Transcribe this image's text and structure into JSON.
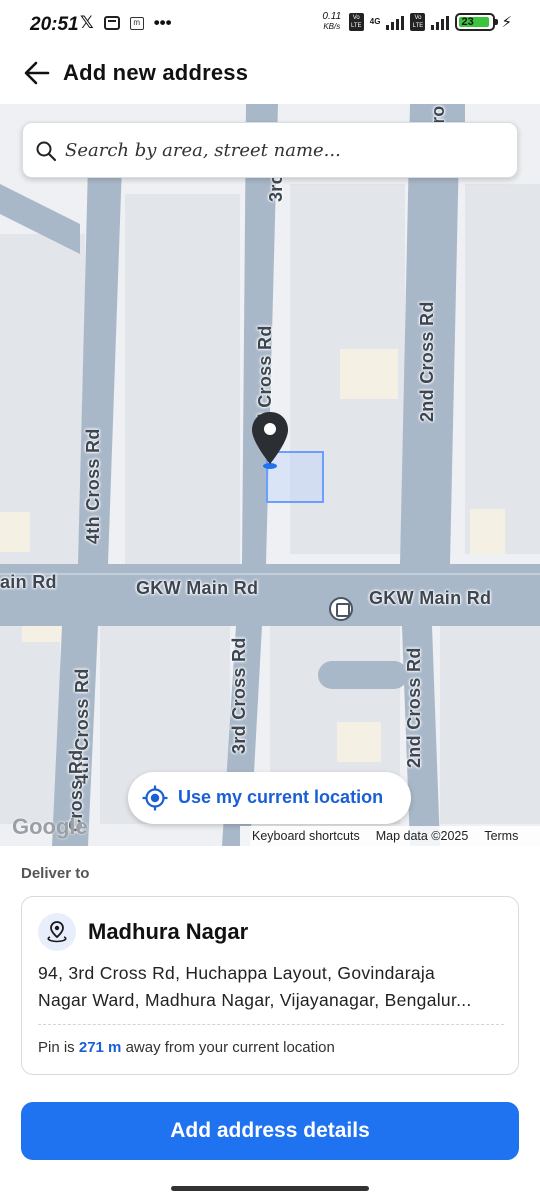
{
  "status_bar": {
    "time": "20:51",
    "icons": [
      "x-icon",
      "message-icon",
      "m-icon",
      "more-icon"
    ],
    "more": "•••",
    "net_speed_value": "0.11",
    "net_speed_unit": "KB/s",
    "network": "4G",
    "volte_label": "Vo LTE",
    "battery": "23",
    "charging": true
  },
  "header": {
    "title": "Add new address"
  },
  "map": {
    "search_placeholder": "Search by area, street name...",
    "road_labels": {
      "gkw_left": "GKW Main Rd",
      "gkw_right": "GKW Main Rd",
      "main_rd_edge": "ain Rd",
      "third_cross_top": "3rd Cross Rd",
      "third_cross_top_partial": "3rc",
      "third_cross_bottom": "3rd Cross Rd",
      "second_cross_top": "2nd Cross Rd",
      "second_cross_bottom": "2nd Cross Rd",
      "fourth_cross_top": "4th Cross Rd",
      "fourth_cross_bottom": "4th Cross Rd",
      "cross_rd_edge": "Cross Rd",
      "rd_top_edge": "ro"
    },
    "use_location_label": "Use my current location",
    "google_logo": "Google",
    "footer": {
      "keyboard_shortcuts": "Keyboard shortcuts",
      "map_data": "Map data ©2025",
      "terms": "Terms"
    }
  },
  "delivery": {
    "section_label": "Deliver to",
    "place_name": "Madhura Nagar",
    "address_line1": "94, 3rd Cross Rd, Huchappa Layout, Govindaraja",
    "address_line2": "Nagar Ward, Madhura Nagar, Vijayanagar, Bengalur...",
    "pin_prefix": "Pin is",
    "pin_distance": "271 m",
    "pin_suffix": "away from your current location"
  },
  "actions": {
    "primary_label": "Add address details"
  }
}
